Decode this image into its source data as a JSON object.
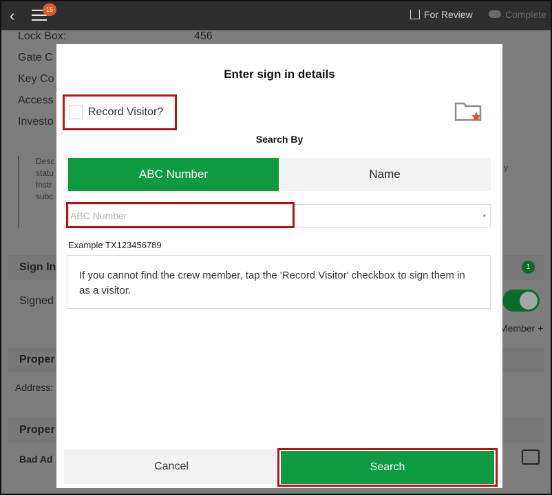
{
  "topbar": {
    "back_glyph": "‹",
    "menu_badge": "15",
    "for_review_label": "For Review",
    "complete_label": "Complete"
  },
  "background": {
    "rows": [
      {
        "label": "Lock Box:",
        "value": "456"
      },
      {
        "label": "Gate C"
      },
      {
        "label": "Key Co"
      },
      {
        "label": "Access"
      },
      {
        "label": "Investo"
      }
    ],
    "note_lines": [
      "Desc",
      "statu",
      "Instr",
      "subc"
    ],
    "note_tail": "y",
    "sign_in_section": "Sign In",
    "sign_in_count": "1",
    "signed_label": "Signed",
    "member_add": "Member +",
    "property_section_1": "Proper",
    "address_label": "Address:",
    "property_section_2": "Proper",
    "bad_address": "Bad Ad"
  },
  "modal": {
    "title": "Enter sign in details",
    "record_visitor_label": "Record Visitor?",
    "record_visitor_checked": false,
    "search_by_label": "Search By",
    "segments": [
      {
        "label": "ABC Number",
        "selected": true
      },
      {
        "label": "Name",
        "selected": false
      }
    ],
    "abc_field": {
      "placeholder": "ABC Number",
      "value": "",
      "required_mark": "•"
    },
    "example_text": "Example TX123456789",
    "info_text": "If you cannot find the crew member, tap the 'Record Visitor' checkbox to sign them in as a visitor.",
    "cancel_label": "Cancel",
    "search_label": "Search"
  },
  "colors": {
    "accent_green": "#0d9a40",
    "highlight_red": "#b4131b",
    "badge_orange": "#e05a2b"
  },
  "icons": {
    "back": "chevron-left-icon",
    "menu": "hamburger-icon",
    "review": "share-icon",
    "complete": "cloud-upload-icon",
    "folder": "folder-star-icon",
    "gallery": "image-icon"
  }
}
